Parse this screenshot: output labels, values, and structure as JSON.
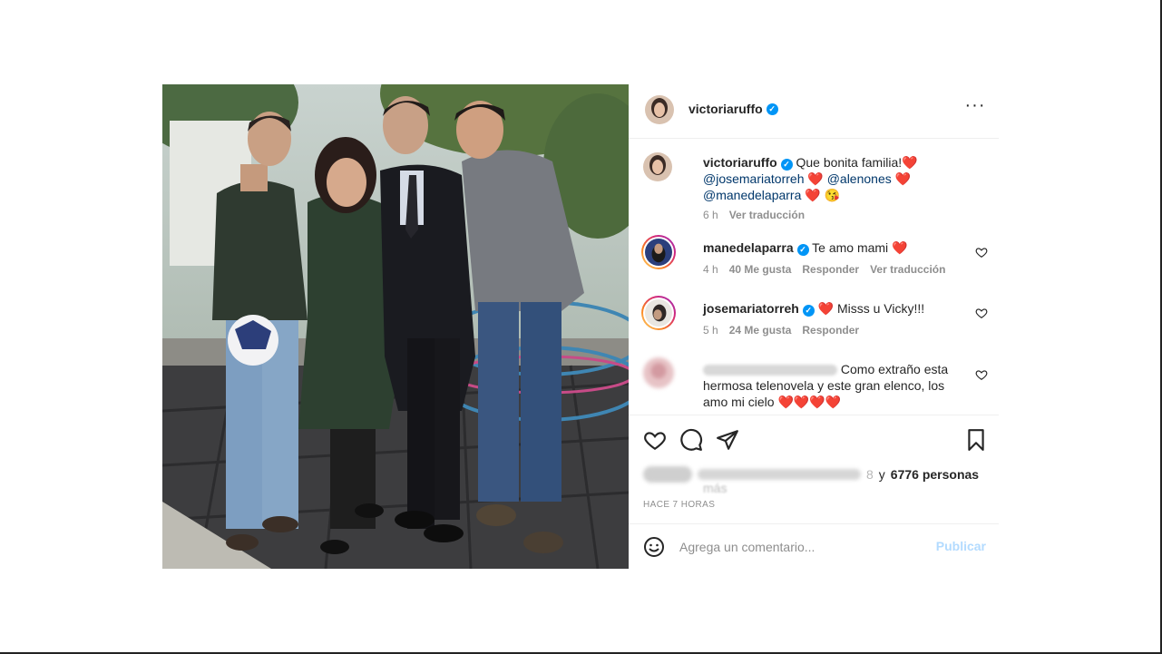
{
  "header": {
    "username": "victoriaruffo",
    "verified_glyph": "✓",
    "more_label": "···"
  },
  "caption": {
    "username": "victoriaruffo",
    "text": "Que bonita familia!",
    "heart1": "❤️",
    "mention1": "@josemariatorreh",
    "heart2": "❤️",
    "mention2": "@alenones",
    "heart3": "❤️",
    "mention3": "@manedelaparra",
    "heart4": "❤️",
    "emoji": "😘",
    "time": "6 h",
    "translate": "Ver traducción"
  },
  "comments": [
    {
      "username": "manedelaparra",
      "text": "Te amo mami",
      "heart": "❤️",
      "time": "4 h",
      "likes": "40 Me gusta",
      "reply": "Responder",
      "translate": "Ver traducción"
    },
    {
      "username": "josemariatorreh",
      "heart": "❤️",
      "text": "Misss u Vicky!!!",
      "time": "5 h",
      "likes": "24 Me gusta",
      "reply": "Responder"
    },
    {
      "text": "Como extraño esta hermosa telenovela y este gran elenco, los amo mi cielo",
      "hearts": "❤️❤️❤️❤️"
    }
  ],
  "likes": {
    "partial_digit": "8",
    "prefix": "y",
    "count": "6776 personas",
    "more": "más"
  },
  "timestamp": "HACE 7 HORAS",
  "add_comment": {
    "placeholder": "Agrega un comentario...",
    "publish": "Publicar"
  },
  "icons": {
    "more": "more-icon",
    "like": "heart-icon",
    "comment": "comment-icon",
    "share": "share-icon",
    "save": "bookmark-icon",
    "emoji": "emoji-icon"
  },
  "colors": {
    "link": "#00376b",
    "verified": "#0095f6",
    "muted": "#8e8e8e",
    "publish_disabled": "#b3dbff"
  }
}
